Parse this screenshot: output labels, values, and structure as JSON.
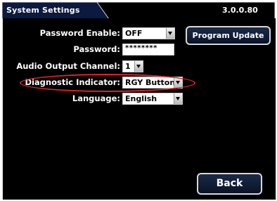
{
  "window": {
    "title": "System Settings",
    "version": "3.0.0.80"
  },
  "settings": {
    "password_enable": {
      "label": "Password Enable:",
      "value": "OFF"
    },
    "password": {
      "label": "Password:",
      "value": "********"
    },
    "audio_output_channel": {
      "label": "Audio Output Channel:",
      "value": "1"
    },
    "diagnostic_indicator": {
      "label": "Diagnostic Indicator:",
      "value": "RGY Button"
    },
    "language": {
      "label": "Language:",
      "value": "English"
    }
  },
  "buttons": {
    "program_update": "Program Update",
    "back": "Back"
  },
  "colors": {
    "panel_background": "#000000",
    "titlebar_background": "#0c1a40",
    "highlight": "#e2212a",
    "button_background": "#12203e"
  }
}
